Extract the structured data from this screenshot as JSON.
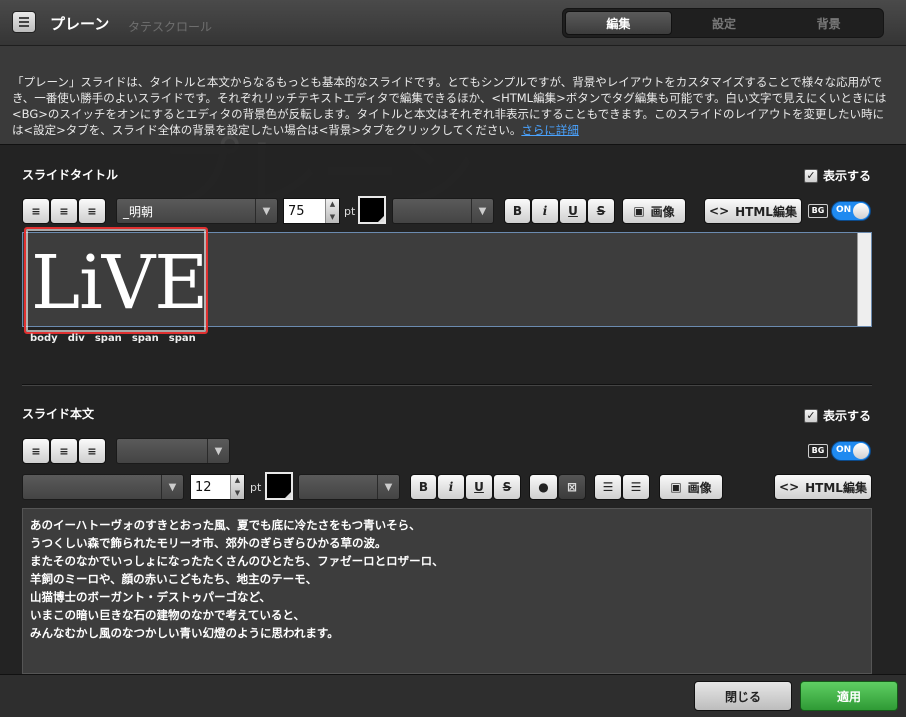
{
  "window": {
    "title": "プレーン",
    "scroll_hint": "タテスクロール"
  },
  "tabs": [
    {
      "label": "編集",
      "active": true
    },
    {
      "label": "設定",
      "active": false
    },
    {
      "label": "背景",
      "active": false
    }
  ],
  "description": {
    "text": "「プレーン」スライドは、タイトルと本文からなるもっとも基本的なスライドです。とてもシンプルですが、背景やレイアウトをカスタマイズすることで様々な応用ができ、一番使い勝手のよいスライドです。それぞれリッチテキストエディタで編集できるほか、<HTML編集>ボタンでタグ編集も可能です。白い文字で見えにくいときには<BG>のスイッチをオンにするとエディタの背景色が反転します。タイトルと本文はそれぞれ非表示にすることもできます。このスライドのレイアウトを変更したい時には<設定>タブを、スライド全体の背景を設定したい場合は<背景>タブをクリックしてください。",
    "link": "さらに詳細"
  },
  "title_section": {
    "label": "スライドタイトル",
    "show_label": "表示する",
    "show_checked": true,
    "font": "_明朝",
    "font_size": "75",
    "unit": "pt",
    "color": "#000000",
    "image_label": "画像",
    "html_label": "HTML編集",
    "bg_label": "BG",
    "toggle_label": "ON",
    "content": "LiVE",
    "breadcrumb": [
      "body",
      "div",
      "span",
      "span",
      "span"
    ]
  },
  "body_section": {
    "label": "スライド本文",
    "show_label": "表示する",
    "show_checked": true,
    "bg_label": "BG",
    "toggle_label": "ON",
    "font_size": "12",
    "unit": "pt",
    "color": "#000000",
    "image_label": "画像",
    "html_label": "HTML編集",
    "lines": [
      "あのイーハトーヴォのすきとおった風、夏でも底に冷たさをもつ青いそら、",
      "うつくしい森で飾られたモリーオ市、郊外のぎらぎらひかる草の波。",
      "またそのなかでいっしょになったたくさんのひとたち、ファゼーロとロザーロ、",
      "羊飼のミーロや、顔の赤いこどもたち、地主のテーモ、",
      "山猫博士のボーガント・デストゥパーゴなど、",
      "いまこの暗い巨きな石の建物のなかで考えていると、",
      "みんなむかし風のなつかしい青い幻燈のように思われます。"
    ]
  },
  "footer": {
    "close_label": "閉じる",
    "apply_label": "適用"
  },
  "colors": {
    "accent": "#1f8af0",
    "apply": "#3fae45",
    "highlight": "#e03030"
  }
}
